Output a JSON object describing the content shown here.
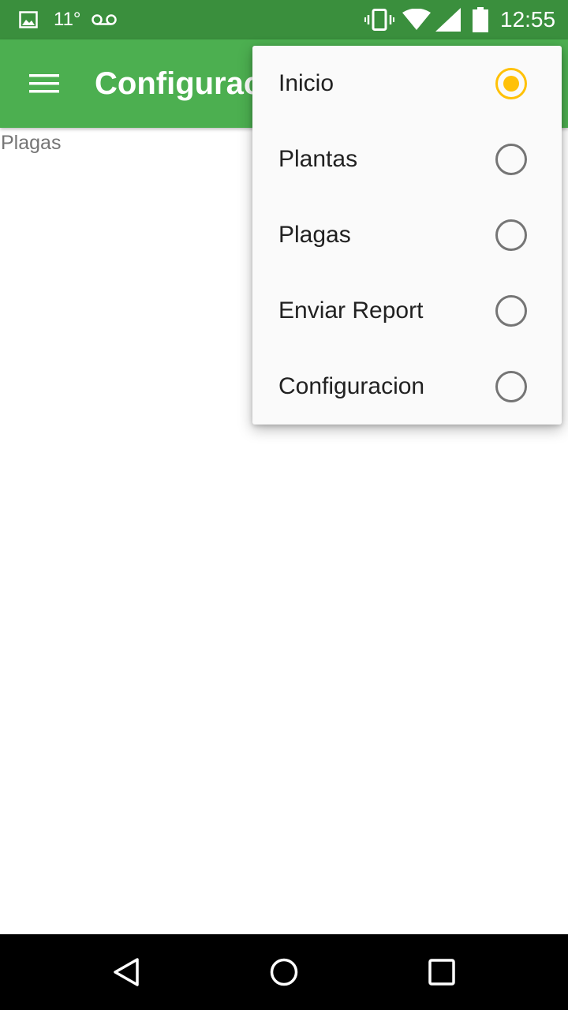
{
  "status_bar": {
    "temperature": "11°",
    "time": "12:55",
    "icons": [
      "image-icon",
      "voicemail-icon",
      "vibrate-icon",
      "wifi-icon",
      "cell-signal-icon",
      "battery-icon"
    ]
  },
  "app_bar": {
    "title": "Configuracion",
    "menu_icon": "hamburger-menu-icon",
    "color": "#4caf50"
  },
  "content": {
    "text": "Plagas"
  },
  "popup_menu": {
    "items": [
      {
        "label": "Inicio",
        "selected": true
      },
      {
        "label": "Plantas",
        "selected": false
      },
      {
        "label": "Plagas",
        "selected": false
      },
      {
        "label": "Enviar Report",
        "selected": false
      },
      {
        "label": "Configuracion",
        "selected": false
      }
    ],
    "accent_color": "#ffc107"
  },
  "nav_bar": {
    "icons": [
      "back-icon",
      "home-icon",
      "recents-icon"
    ]
  }
}
